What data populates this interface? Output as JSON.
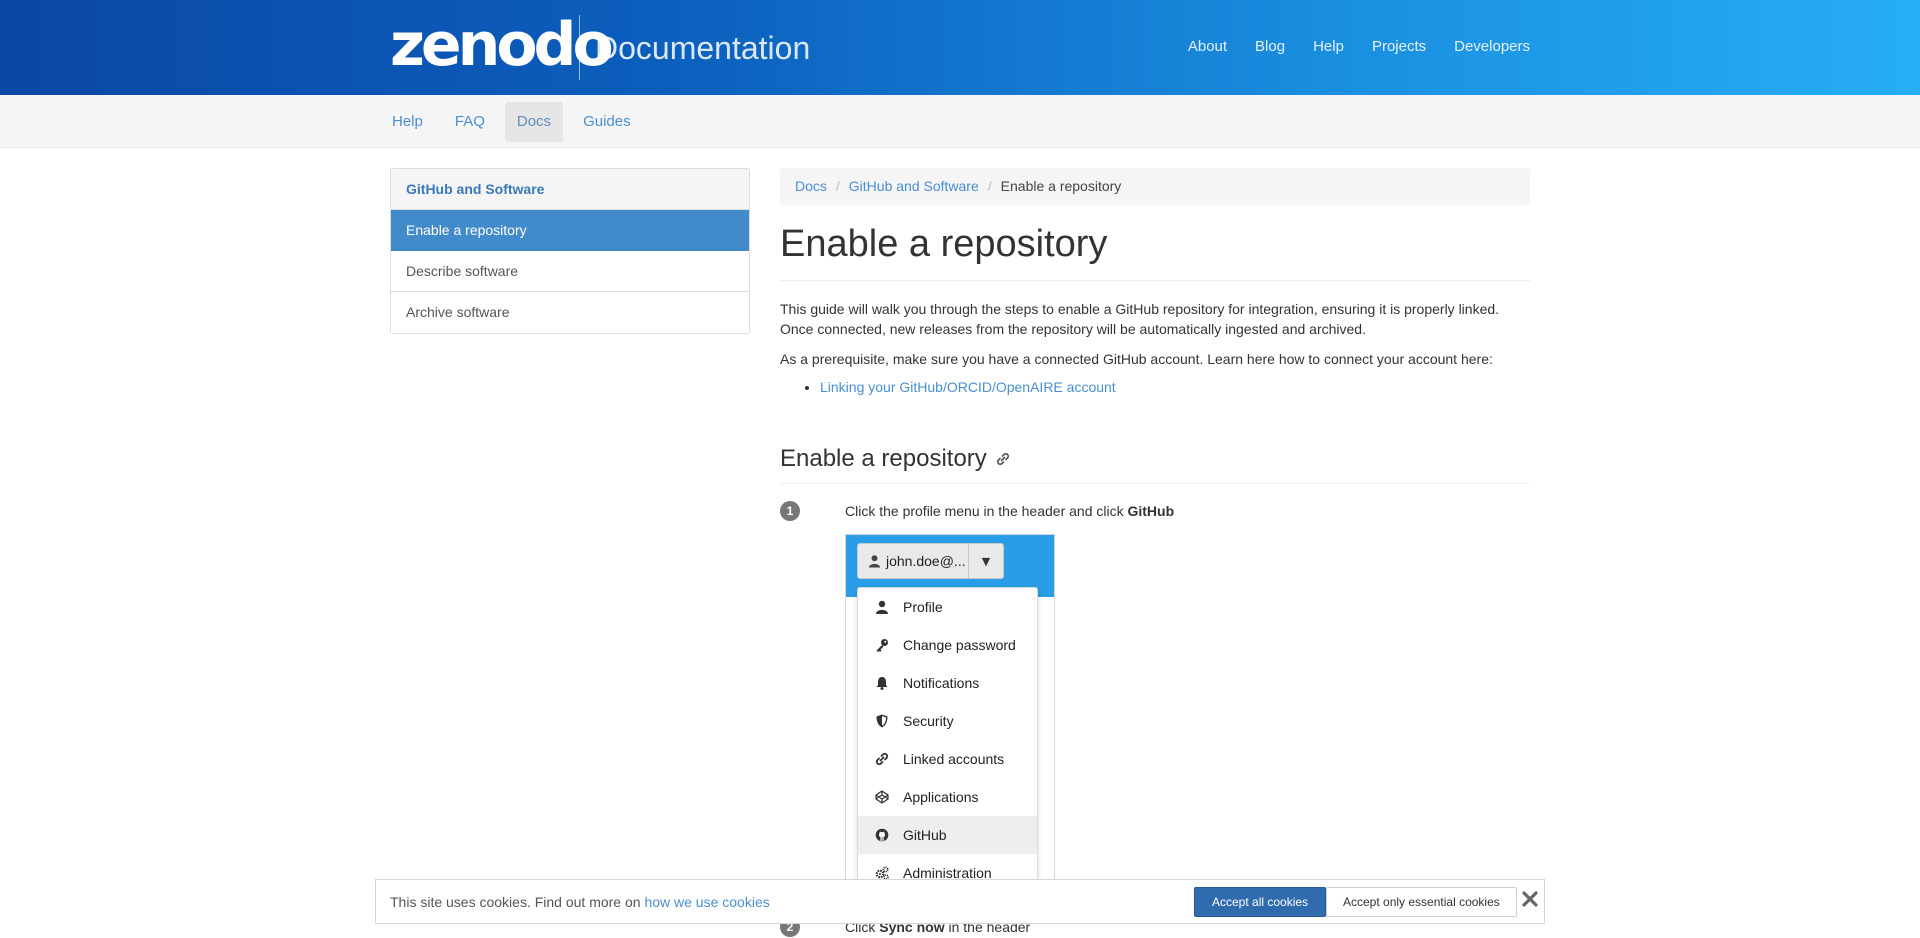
{
  "header": {
    "logo_text": "zenodo",
    "title": "Documentation",
    "nav": [
      "About",
      "Blog",
      "Help",
      "Projects",
      "Developers"
    ]
  },
  "subnav": {
    "items": [
      "Help",
      "FAQ",
      "Docs",
      "Guides"
    ],
    "active": "Docs"
  },
  "sidebar": {
    "heading": "GitHub and Software",
    "items": [
      {
        "label": "Enable a repository",
        "active": true
      },
      {
        "label": "Describe software",
        "active": false
      },
      {
        "label": "Archive software",
        "active": false
      }
    ]
  },
  "breadcrumb": [
    "Docs",
    "GitHub and Software",
    "Enable a repository"
  ],
  "content": {
    "title": "Enable a repository",
    "intro": "This guide will walk you through the steps to enable a GitHub repository for integration, ensuring it is properly linked. Once connected, new releases from the repository will be automatically ingested and archived.",
    "prereq": "As a prerequisite, make sure you have a connected GitHub account. Learn here how to connect your account here:",
    "prereq_link": "Linking your GitHub/ORCID/OpenAIRE account",
    "section_title": "Enable a repository",
    "steps": [
      {
        "num": "1",
        "text_before": "Click the profile menu in the header and click ",
        "text_bold": "GitHub",
        "text_after": ""
      },
      {
        "num": "2",
        "text_before": "Click ",
        "text_bold": "Sync now",
        "text_after": " in the header"
      }
    ]
  },
  "profile_menu": {
    "user_label": "john.doe@...",
    "items": [
      {
        "label": "Profile",
        "icon": "user-icon"
      },
      {
        "label": "Change password",
        "icon": "key-icon"
      },
      {
        "label": "Notifications",
        "icon": "bell-icon"
      },
      {
        "label": "Security",
        "icon": "shield-icon"
      },
      {
        "label": "Linked accounts",
        "icon": "link-icon"
      },
      {
        "label": "Applications",
        "icon": "codepen-icon"
      },
      {
        "label": "GitHub",
        "icon": "github-icon",
        "highlighted": true
      },
      {
        "label": "Administration",
        "icon": "cogs-icon"
      }
    ]
  },
  "cookie_banner": {
    "text": "This site uses cookies. Find out more on ",
    "link": "how we use cookies",
    "accept_all": "Accept all cookies",
    "accept_essential": "Accept only essential cookies"
  },
  "colors": {
    "header_start": "#0b47a5",
    "header_end": "#27aef6",
    "link": "#4a8fd0",
    "active_sidebar": "#428bca",
    "accept_button": "#2f6bad"
  }
}
